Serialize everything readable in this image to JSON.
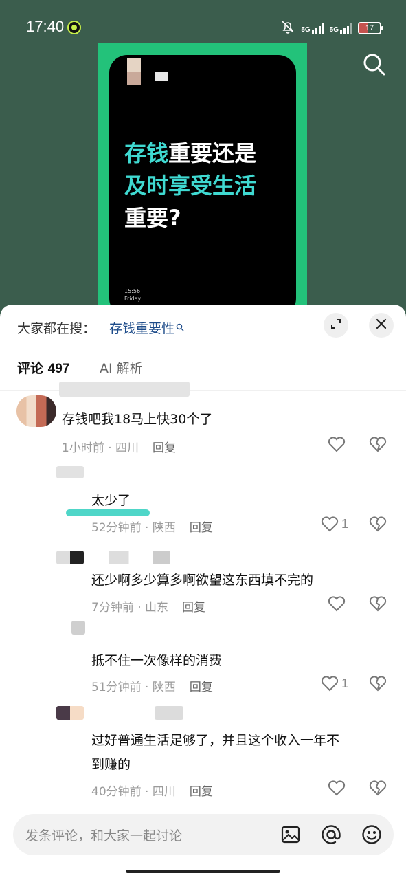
{
  "status": {
    "time": "17:40",
    "network": "5G",
    "battery": "17"
  },
  "video": {
    "headline_highlight_1": "存钱",
    "headline_rest_1": "重要还是",
    "headline_highlight_2": "及时享受生活",
    "headline_rest_3": "重要?",
    "phone_clock": "15:56",
    "phone_day": "Friday"
  },
  "sheet": {
    "hot_search_label": "大家都在搜：",
    "hot_search_term": "存钱重要性",
    "tabs": [
      {
        "label": "评论",
        "count": "497"
      },
      {
        "label": "AI 解析"
      }
    ]
  },
  "comments": [
    {
      "text": "存钱吧我18马上快30个了",
      "time": "1小时前",
      "location": "四川",
      "reply": "回复",
      "likes": ""
    },
    {
      "text": "太少了",
      "time": "52分钟前",
      "location": "陕西",
      "reply": "回复",
      "likes": "1"
    },
    {
      "text": "还少啊多少算多啊欲望这东西填不完的",
      "time": "7分钟前",
      "location": "山东",
      "reply": "回复",
      "likes": ""
    },
    {
      "text": "抵不住一次像样的消费",
      "time": "51分钟前",
      "location": "陕西",
      "reply": "回复",
      "likes": "1"
    },
    {
      "text_line1": "过好普通生活足够了，并且这个收入一年不",
      "text_line2": "到赚的",
      "time": "40分钟前",
      "location": "四川",
      "reply": "回复",
      "likes": ""
    }
  ],
  "input": {
    "placeholder": "发条评论，和大家一起讨论"
  },
  "icons": [
    "search-icon",
    "expand-icon",
    "close-icon",
    "heart-icon",
    "broken-heart-icon",
    "image-icon",
    "at-icon",
    "emoji-icon"
  ]
}
